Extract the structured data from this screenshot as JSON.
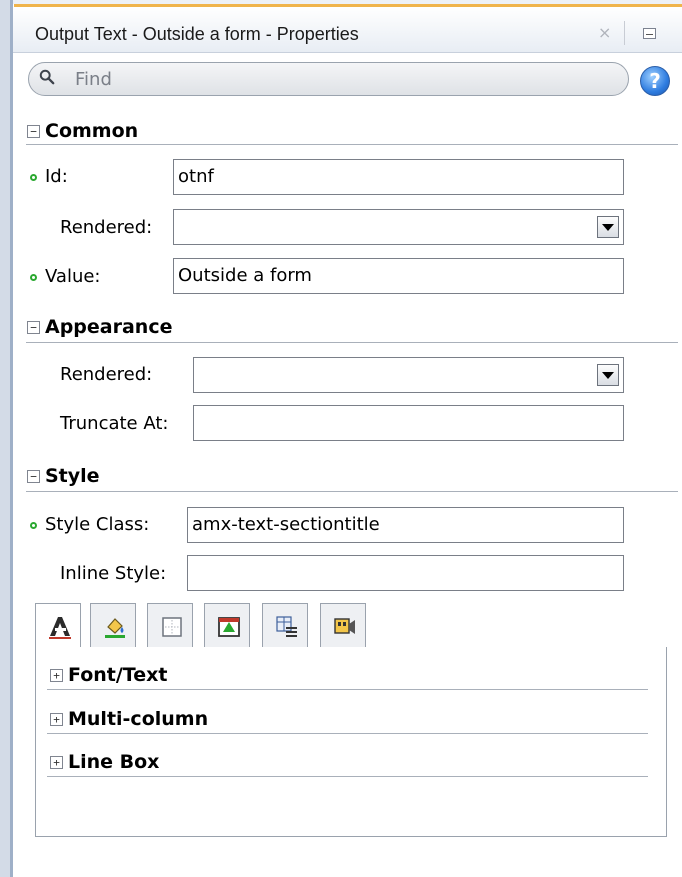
{
  "window": {
    "title": "Output Text - Outside a form - Properties",
    "close_glyph": "×",
    "minimize_icon": "minimize-icon"
  },
  "search": {
    "placeholder": "Find",
    "icon": "search-icon",
    "help_label": "?"
  },
  "sections": {
    "common": {
      "toggle": "−",
      "title": "Common",
      "fields": {
        "id_label": "Id:",
        "id_value": "otnf",
        "rendered_label": "Rendered:",
        "rendered_value": "",
        "value_label": "Value:",
        "value_value": "Outside a form"
      }
    },
    "appearance": {
      "toggle": "−",
      "title": "Appearance",
      "fields": {
        "rendered_label": "Rendered:",
        "rendered_value": "",
        "truncate_label": "Truncate At:",
        "truncate_value": ""
      }
    },
    "style": {
      "toggle": "−",
      "title": "Style",
      "fields": {
        "styleclass_label": "Style Class:",
        "styleclass_value": "amx-text-sectiontitle",
        "inlinestyle_label": "Inline Style:",
        "inlinestyle_value": ""
      }
    }
  },
  "style_tabs": [
    {
      "icon": "text-format-icon",
      "active": true
    },
    {
      "icon": "background-fill-icon",
      "active": false
    },
    {
      "icon": "border-box-icon",
      "active": false
    },
    {
      "icon": "box-model-icon",
      "active": false
    },
    {
      "icon": "table-layout-icon",
      "active": false
    },
    {
      "icon": "media-icon",
      "active": false
    }
  ],
  "style_panel": {
    "groups": [
      {
        "toggle": "+",
        "title": "Font/Text"
      },
      {
        "toggle": "+",
        "title": "Multi-column"
      },
      {
        "toggle": "+",
        "title": "Line Box"
      }
    ]
  },
  "colors": {
    "required_dot": "#2aa830",
    "accent_orange": "#f0b44c",
    "help_blue": "#2f7de0"
  }
}
